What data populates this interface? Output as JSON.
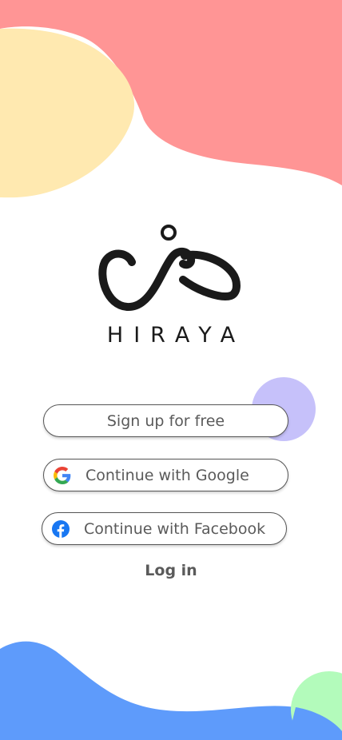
{
  "app": {
    "brand_name": "HIRAYA",
    "logo_icon": "hiraya-infinity-logo-icon"
  },
  "actions": {
    "signup_label": "Sign up for free",
    "google_label": "Continue with Google",
    "google_icon": "google-g-icon",
    "facebook_label": "Continue with Facebook",
    "facebook_icon": "facebook-f-icon",
    "login_label": "Log in"
  },
  "colors": {
    "coral": "#FF9595",
    "yellow": "#FFE9B0",
    "purple": "#C6C1FA",
    "blue": "#5E9BFB",
    "green": "#B3FBBB",
    "facebook_blue": "#1877F2",
    "text_gray": "#5A5A5A",
    "logo_black": "#1A1A1A"
  }
}
